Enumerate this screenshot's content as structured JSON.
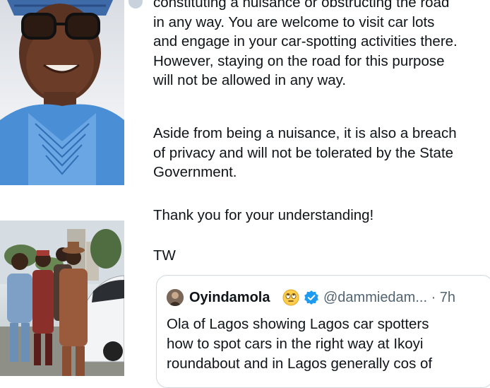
{
  "tweet": {
    "paragraphs": [
      "constituting a nuisance or obstructing the road\nin any way. You are welcome to visit car lots\nand engage in your car-spotting activities there.\nHowever, staying on the road for this purpose\nwill not be allowed in any way.",
      "Aside from being a nuisance, it is also a breach\nof privacy and will not be tolerated by the State\nGovernment.",
      "Thank you for your understanding!",
      "TW"
    ]
  },
  "quote": {
    "name": "Oyindamola",
    "emoji": "face-with-rolling-eyes",
    "handle": "@dammiedam... · 7h",
    "text": "Ola of Lagos showing Lagos car spotters\nhow to spot cars in the right way at Ikoyi\nroundabout and in Lagos generally cos of"
  },
  "icons": {
    "verified": "verified-badge-icon"
  },
  "colors": {
    "text": "#0f1419",
    "secondary": "#536471",
    "border": "#cfd9de",
    "verified": "#1d9bf0"
  }
}
